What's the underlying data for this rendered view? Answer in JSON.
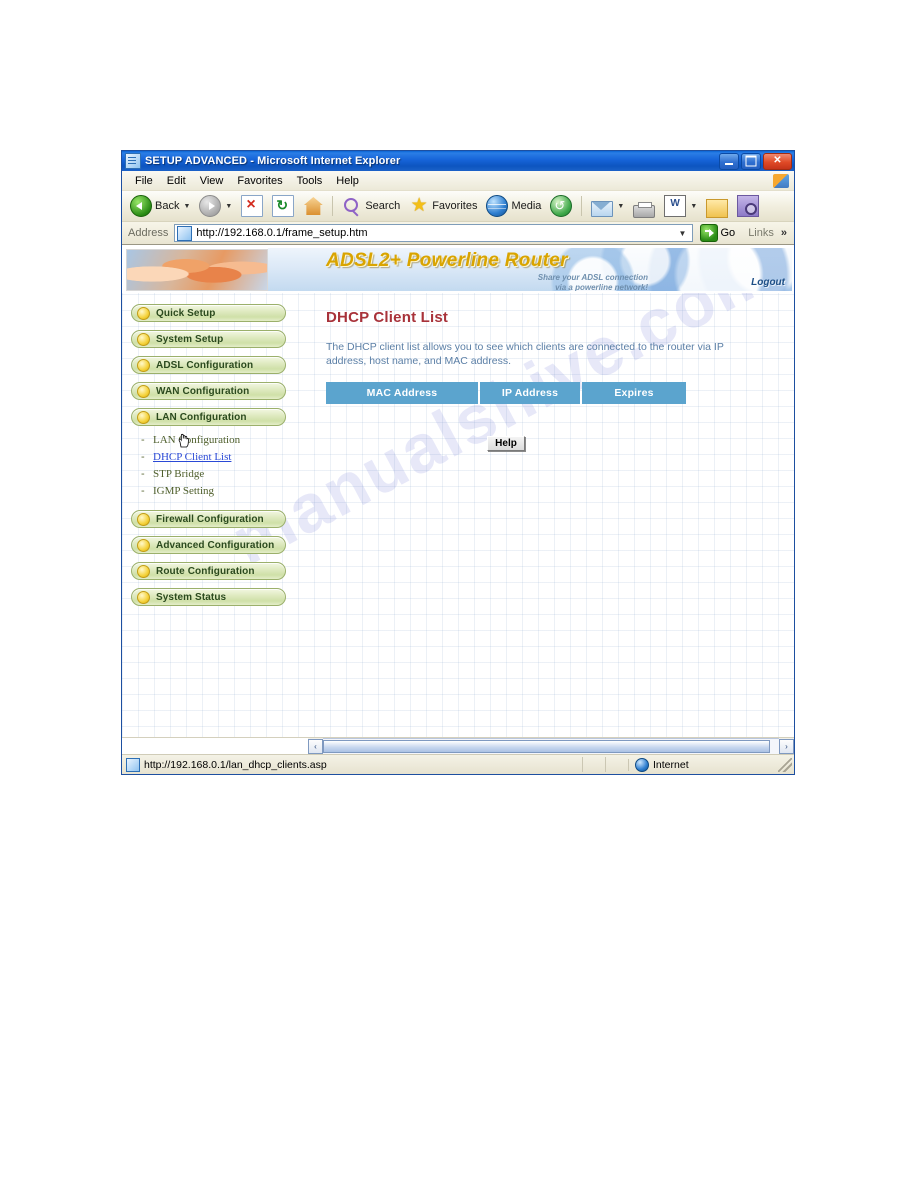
{
  "window": {
    "title": "SETUP ADVANCED - Microsoft Internet Explorer",
    "min_label": "",
    "max_label": "",
    "close_label": "✕"
  },
  "menubar": {
    "items": [
      "File",
      "Edit",
      "View",
      "Favorites",
      "Tools",
      "Help"
    ]
  },
  "toolbar": {
    "back_label": "Back",
    "back_arrow": "▼",
    "forward_arrow": "▼",
    "search_label": "Search",
    "favorites_label": "Favorites",
    "media_label": "Media",
    "mail_arrow": "▼",
    "edit_arrow": "▼"
  },
  "addressbar": {
    "label": "Address",
    "url": "http://192.168.0.1/frame_setup.htm",
    "dropdown_caret": "▼",
    "go_label": "Go",
    "links_label": "Links",
    "chevron": "»"
  },
  "banner": {
    "title": "ADSL2+ Powerline Router",
    "subtitle": "Share your ADSL connection\nvia a powerline network!",
    "logout_label": "Logout"
  },
  "sidebar": {
    "buttons": [
      {
        "label": "Quick Setup"
      },
      {
        "label": "System Setup"
      },
      {
        "label": "ADSL Configuration"
      },
      {
        "label": "WAN Configuration"
      },
      {
        "label": "LAN Configuration"
      }
    ],
    "subitems": [
      {
        "label": "LAN Configuration",
        "active": false
      },
      {
        "label": "DHCP Client List",
        "active": true
      },
      {
        "label": "STP Bridge",
        "active": false
      },
      {
        "label": "IGMP Setting",
        "active": false
      }
    ],
    "dash": "-",
    "buttons_lower": [
      {
        "label": "Firewall Configuration"
      },
      {
        "label": "Advanced Configuration"
      },
      {
        "label": "Route Configuration"
      },
      {
        "label": "System Status"
      }
    ]
  },
  "content": {
    "heading": "DHCP Client List",
    "description": "The DHCP client list allows you to see which clients are connected to the router via IP address, host name, and MAC address.",
    "table": {
      "headers": [
        "MAC Address",
        "IP Address",
        "Expires"
      ],
      "rows": []
    },
    "help_label": "Help"
  },
  "watermark": {
    "line1": "manualshive.com",
    "line2": "manualshive"
  },
  "scrollbar": {
    "left_arrow": "‹",
    "right_arrow": "›"
  },
  "statusbar": {
    "url": "http://192.168.0.1/lan_dhcp_clients.asp",
    "zone": "Internet"
  },
  "colors": {
    "titlebar_blue": "#1663d8",
    "table_header_blue": "#5ba4ce",
    "heading_red": "#a8323a",
    "desc_blue": "#5b7fa6",
    "pill_green": "#cfe0a8",
    "banner_gold": "#d9a400",
    "link_blue": "#2a49d6"
  }
}
